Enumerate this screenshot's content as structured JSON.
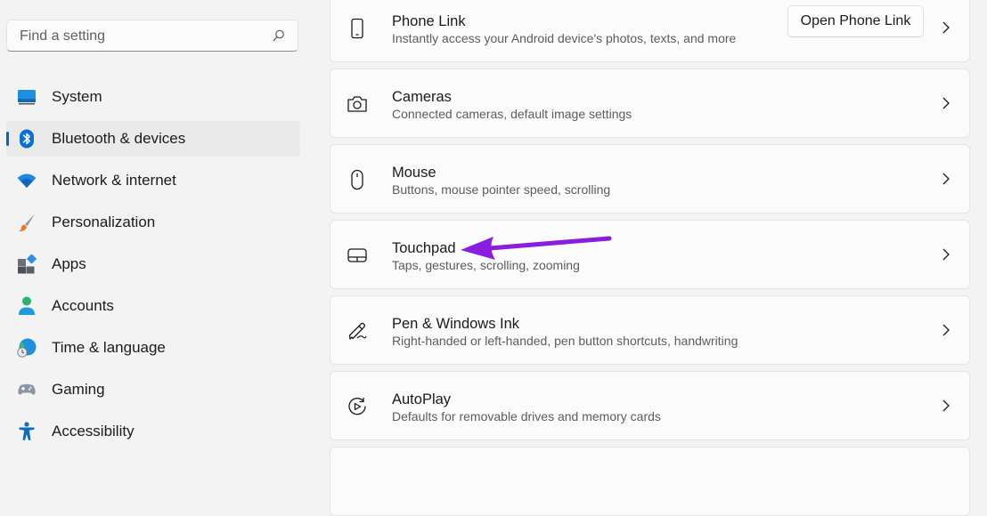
{
  "search": {
    "placeholder": "Find a setting",
    "icon": "search-icon"
  },
  "sidebar": {
    "items": [
      {
        "label": "System",
        "icon": "system-icon"
      },
      {
        "label": "Bluetooth & devices",
        "icon": "bluetooth-icon",
        "active": true
      },
      {
        "label": "Network & internet",
        "icon": "wifi-icon"
      },
      {
        "label": "Personalization",
        "icon": "brush-icon"
      },
      {
        "label": "Apps",
        "icon": "apps-icon"
      },
      {
        "label": "Accounts",
        "icon": "person-icon"
      },
      {
        "label": "Time & language",
        "icon": "globe-clock-icon"
      },
      {
        "label": "Gaming",
        "icon": "gamepad-icon"
      },
      {
        "label": "Accessibility",
        "icon": "accessibility-icon"
      }
    ]
  },
  "cards": [
    {
      "title": "Phone Link",
      "description": "Instantly access your Android device's photos, texts, and more",
      "icon": "phone-icon",
      "button": "Open Phone Link"
    },
    {
      "title": "Cameras",
      "description": "Connected cameras, default image settings",
      "icon": "camera-icon"
    },
    {
      "title": "Mouse",
      "description": "Buttons, mouse pointer speed, scrolling",
      "icon": "mouse-icon"
    },
    {
      "title": "Touchpad",
      "description": "Taps, gestures, scrolling, zooming",
      "icon": "touchpad-icon"
    },
    {
      "title": "Pen & Windows Ink",
      "description": "Right-handed or left-handed, pen button shortcuts, handwriting",
      "icon": "pen-icon"
    },
    {
      "title": "AutoPlay",
      "description": "Defaults for removable drives and memory cards",
      "icon": "autoplay-icon"
    }
  ],
  "colors": {
    "accent": "#0067c0",
    "annotation_arrow": "#8a1ee0"
  }
}
